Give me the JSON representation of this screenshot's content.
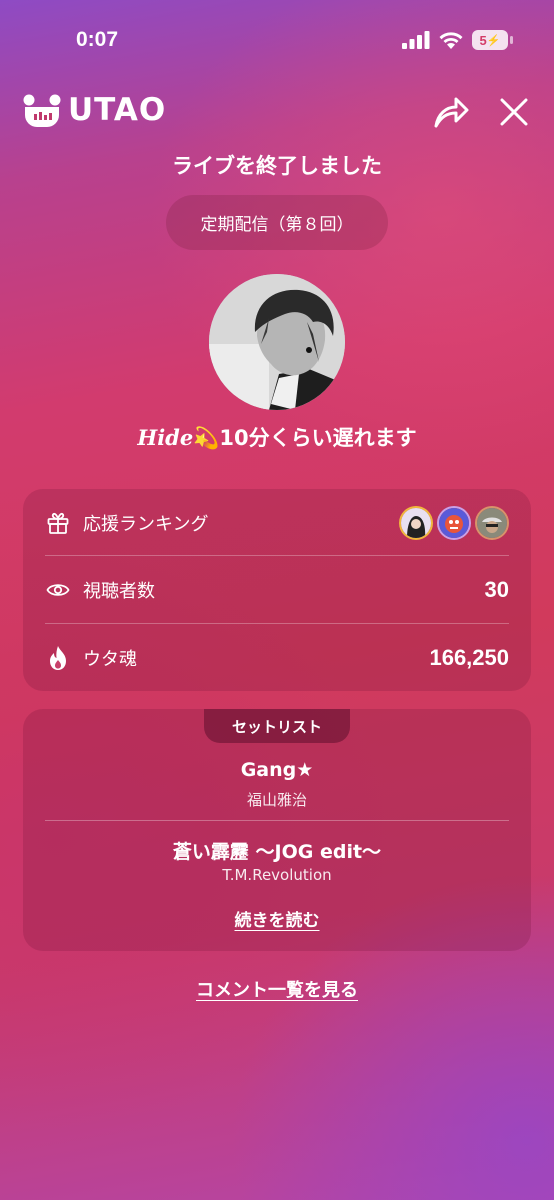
{
  "status_bar": {
    "time": "0:07",
    "battery": "5"
  },
  "header": {
    "logo_text": "UTAO",
    "share_icon": "share-icon",
    "close_icon": "close-icon"
  },
  "ended_title": "ライブを終了しました",
  "broadcast_label": "定期配信（第８回）",
  "user": {
    "name_prefix": "Hide",
    "name_emoji": "💫",
    "name_rest": "10分くらい遅れます"
  },
  "stats": {
    "ranking_label": "応援ランキング",
    "viewers_label": "視聴者数",
    "viewers_value": "30",
    "soul_label": "ウタ魂",
    "soul_value": "166,250"
  },
  "setlist": {
    "tab_label": "セットリスト",
    "songs": [
      {
        "title": "Gang★",
        "artist": "福山雅治"
      },
      {
        "title": "蒼い霹靂 〜JOG edit〜",
        "artist": "T.M.Revolution"
      }
    ],
    "read_more": "続きを読む"
  },
  "comments_link": "コメント一覧を見る",
  "colors": {
    "rank_gold": "#f0b73c",
    "rank_purple": "#c9a0e6",
    "rank_bronze": "#d8936a"
  }
}
